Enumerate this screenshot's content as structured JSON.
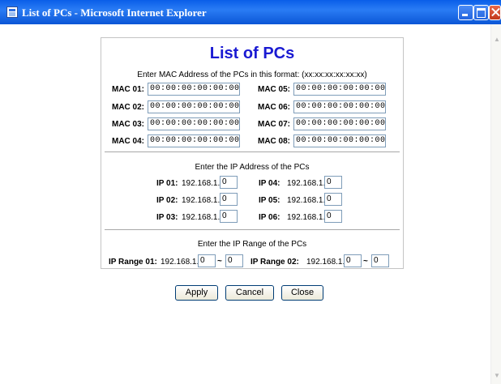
{
  "window": {
    "title": "List of PCs - Microsoft Internet Explorer"
  },
  "page_title": "List of PCs",
  "mac_section": {
    "instruction": "Enter MAC Address of the PCs in this format: (xx:xx:xx:xx:xx:xx)",
    "entries": [
      {
        "label": "MAC 01:",
        "value": "00:00:00:00:00:00"
      },
      {
        "label": "MAC 02:",
        "value": "00:00:00:00:00:00"
      },
      {
        "label": "MAC 03:",
        "value": "00:00:00:00:00:00"
      },
      {
        "label": "MAC 04:",
        "value": "00:00:00:00:00:00"
      },
      {
        "label": "MAC 05:",
        "value": "00:00:00:00:00:00"
      },
      {
        "label": "MAC 06:",
        "value": "00:00:00:00:00:00"
      },
      {
        "label": "MAC 07:",
        "value": "00:00:00:00:00:00"
      },
      {
        "label": "MAC 08:",
        "value": "00:00:00:00:00:00"
      }
    ]
  },
  "ip_section": {
    "instruction": "Enter the IP Address of the PCs",
    "prefix": "192.168.1.",
    "entries": [
      {
        "label": "IP 01:",
        "value": "0"
      },
      {
        "label": "IP 02:",
        "value": "0"
      },
      {
        "label": "IP 03:",
        "value": "0"
      },
      {
        "label": "IP 04:",
        "value": "0"
      },
      {
        "label": "IP 05:",
        "value": "0"
      },
      {
        "label": "IP 06:",
        "value": "0"
      }
    ]
  },
  "range_section": {
    "instruction": "Enter the IP Range of the PCs",
    "prefix": "192.168.1.",
    "separator": "~",
    "ranges": [
      {
        "label": "IP Range 01:",
        "start": "0",
        "end": "0"
      },
      {
        "label": "IP Range 02:",
        "start": "0",
        "end": "0"
      }
    ]
  },
  "buttons": {
    "apply": "Apply",
    "cancel": "Cancel",
    "close": "Close"
  },
  "icons": {
    "app": "internet-explorer-icon",
    "minimize": "minimize-icon",
    "maximize": "maximize-icon",
    "close": "close-icon",
    "scroll_up": "scroll-up-arrow-icon",
    "scroll_down": "scroll-down-arrow-icon"
  },
  "colors": {
    "title_bar": "#0a5ee8",
    "heading": "#1a1ad2",
    "field_border": "#7f9db9"
  }
}
